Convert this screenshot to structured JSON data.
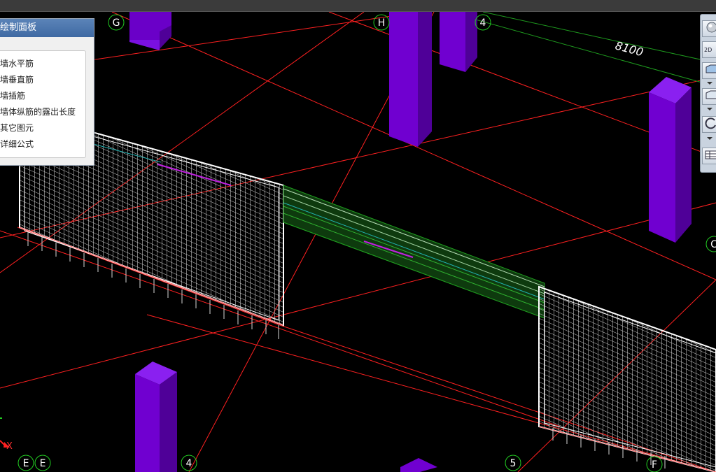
{
  "control_panel": {
    "title": "绘制面板",
    "items": [
      {
        "label": "墙水平筋"
      },
      {
        "label": "墙垂直筋"
      },
      {
        "label": "墙插筋"
      },
      {
        "label": "墙体纵筋的露出长度"
      },
      {
        "label": "其它图元"
      },
      {
        "label": "详细公式"
      }
    ]
  },
  "axis_labels": {
    "g": "G",
    "h": "H",
    "top_4": "4",
    "e1": "E",
    "e2": "E",
    "bottom_4": "4",
    "bottom_5": "5",
    "right_c": "C",
    "bottom_f": "F"
  },
  "dimension_text": "8100",
  "coord_x_label": "X",
  "toolbox": {
    "view_2d_label": "2D"
  },
  "colors": {
    "background": "#000000",
    "grid_line": "#ff2020",
    "dim_line": "#1e9a1e",
    "column": "#7000d0",
    "rebar_mesh": "#e8e8e8",
    "beam": "#1f7a1f",
    "axis_marker": "#22cc22"
  }
}
